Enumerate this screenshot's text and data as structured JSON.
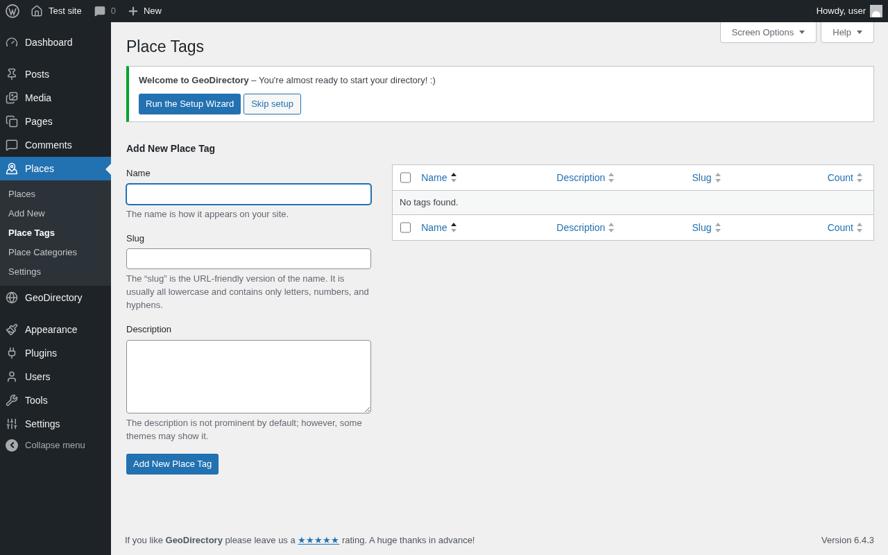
{
  "admin_bar": {
    "site": "Test site",
    "comments": "0",
    "new": "New",
    "howdy": "Howdy, user"
  },
  "menu_groups": [
    [
      {
        "label": "Dashboard",
        "selected": false
      }
    ],
    [
      {
        "label": "Posts",
        "selected": false
      },
      {
        "label": "Media",
        "selected": false
      },
      {
        "label": "Pages",
        "selected": false
      },
      {
        "label": "Comments",
        "selected": false
      },
      {
        "label": "Places",
        "selected": true,
        "children": [
          {
            "label": "Places",
            "selected": false
          },
          {
            "label": "Add New",
            "selected": false
          },
          {
            "label": "Place Tags",
            "selected": true
          },
          {
            "label": "Place Categories",
            "selected": false
          },
          {
            "label": "Settings",
            "selected": false
          }
        ]
      },
      {
        "label": "GeoDirectory",
        "selected": false
      }
    ],
    [
      {
        "label": "Appearance",
        "selected": false
      },
      {
        "label": "Plugins",
        "selected": false
      },
      {
        "label": "Users",
        "selected": false
      },
      {
        "label": "Tools",
        "selected": false
      },
      {
        "label": "Settings",
        "selected": false
      }
    ]
  ],
  "collapse": "Collapse menu",
  "screen_options": "Screen Options",
  "help": "Help",
  "title": "Place Tags",
  "notice": {
    "text": "**Welcome to GeoDirectory** – You're almost ready to start your directory! :)",
    "primary": "Run the Setup Wizard",
    "secondary": "Skip setup"
  },
  "form": {
    "heading": "Add New Place Tag",
    "fields": [
      {
        "kind": "input",
        "label": "Name",
        "focused": true,
        "help": "The name is how it appears on your site."
      },
      {
        "kind": "input",
        "label": "Slug",
        "focused": false,
        "help": "The “slug” is the URL-friendly version of the name. It is usually all lowercase and contains only letters, numbers, and hyphens."
      },
      {
        "kind": "textarea",
        "label": "Description",
        "focused": false,
        "help": "The description is not prominent by default; however, some themes may show it."
      }
    ],
    "submit": "Add New Place Tag"
  },
  "table": {
    "header_columns": [
      {
        "label": "Name",
        "sorted": true
      },
      {
        "label": "Description",
        "sorted": false
      },
      {
        "label": "Slug",
        "sorted": false
      },
      {
        "label": "Count",
        "sorted": false
      }
    ],
    "footer_columns": [
      {
        "label": "Name",
        "sorted": true
      },
      {
        "label": "Description",
        "sorted": false
      },
      {
        "label": "Slug",
        "sorted": false
      },
      {
        "label": "Count",
        "sorted": false
      }
    ],
    "header_checked": false,
    "footer_checked": false,
    "empty": "No tags found."
  },
  "footer": {
    "before": "If you like **GeoDirectory** please leave us a",
    "link": "★★★★★",
    "after": "rating. A huge thanks in advance!",
    "version": "Version 6.4.3"
  }
}
